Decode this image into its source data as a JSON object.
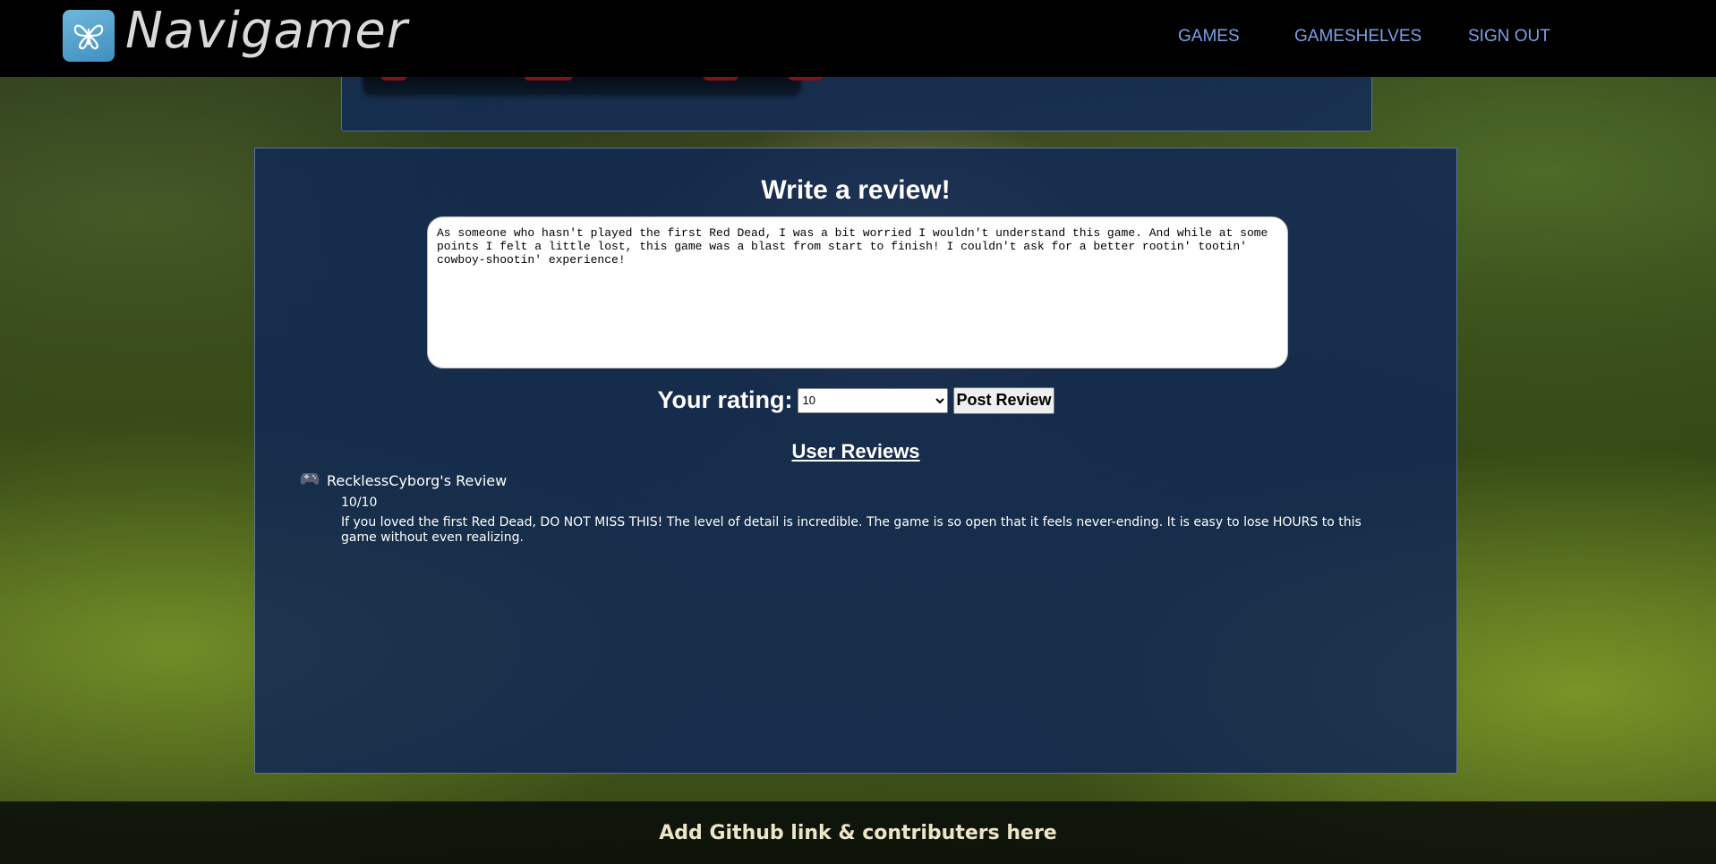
{
  "nav": {
    "brand": "Navigamer",
    "links": [
      "GAMES",
      "GAMESHELVES",
      "SIGN OUT"
    ]
  },
  "write_review": {
    "title": "Write a review!",
    "text": "As someone who hasn't played the first Red Dead, I was a bit worried I wouldn't understand this game. And while at some points I felt a little lost, this game was a blast from start to finish! I couldn't ask for a better rootin' tootin' cowboy-shootin' experience!",
    "rating_label": "Your rating:",
    "rating_value": "10",
    "post_button": "Post Review"
  },
  "user_reviews": {
    "heading": "User Reviews",
    "items": [
      {
        "author": "RecklessCyborg's Review",
        "score": "10/10",
        "body": "If you loved the first Red Dead, DO NOT MISS THIS! The level of detail is incredible. The game is so open that it feels never-ending. It is easy to lose HOURS to this game without even realizing."
      }
    ]
  },
  "footer": {
    "text": "Add Github link & contributers here"
  },
  "colors": {
    "nav_link": "#7aa0e8",
    "panel": "#102854",
    "footer_text": "#ece6c8"
  },
  "icons": {
    "brand": "butterfly-icon",
    "reviewer": "gamepad-icon"
  }
}
